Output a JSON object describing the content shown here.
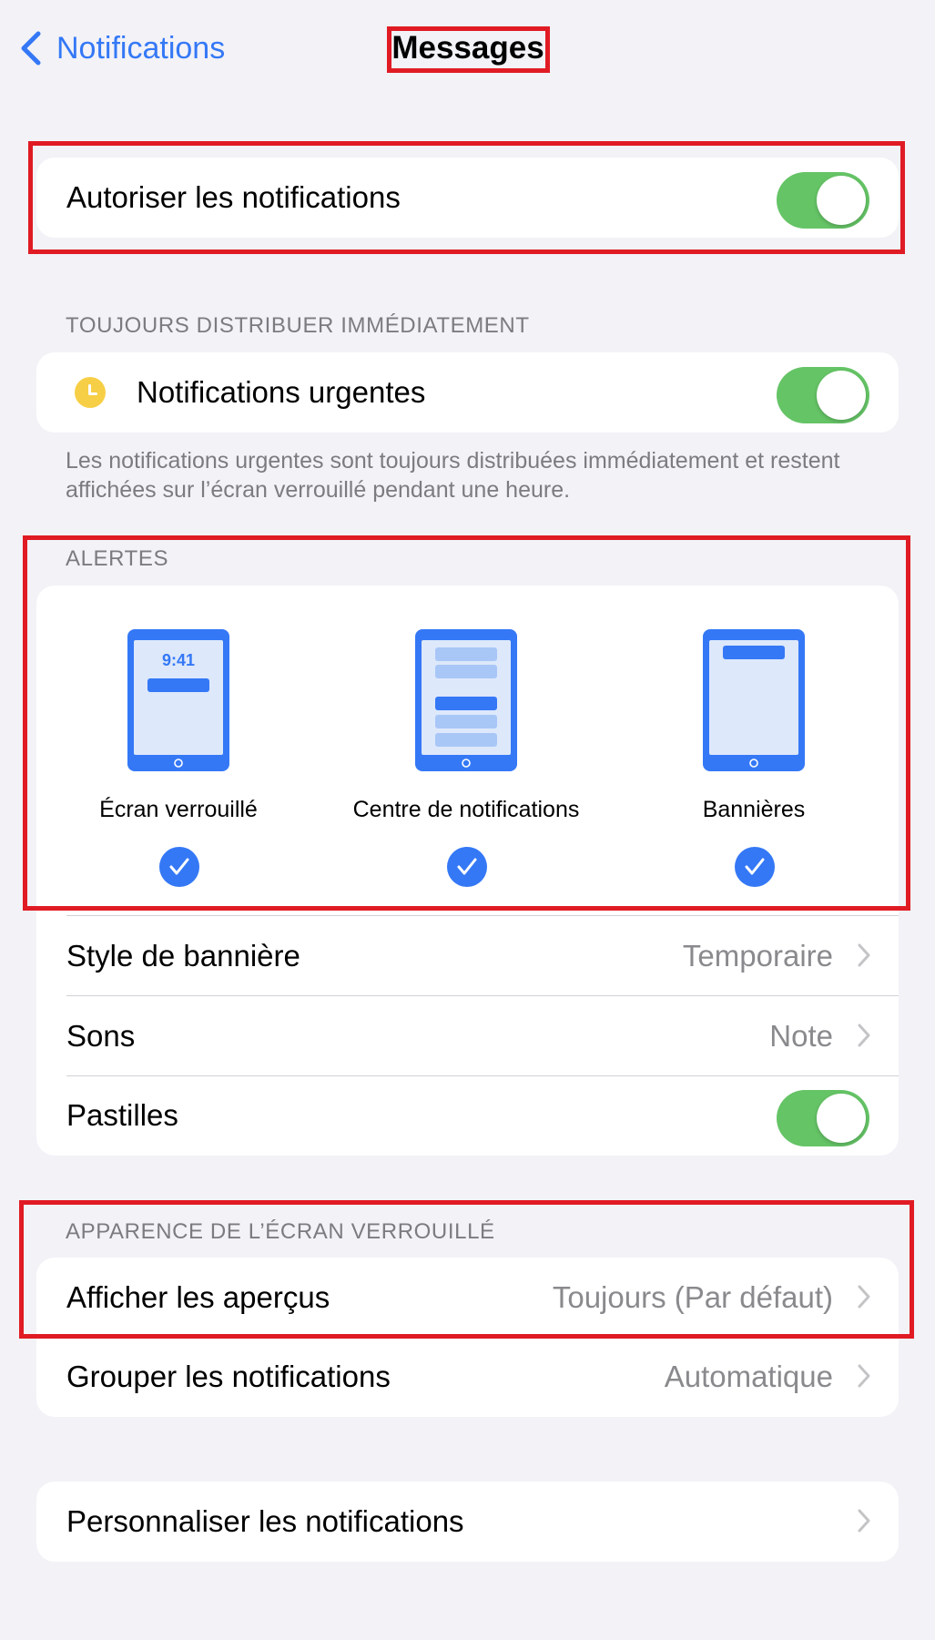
{
  "nav": {
    "back_label": "Notifications",
    "title": "Messages"
  },
  "allow": {
    "label": "Autoriser les notifications",
    "enabled": true
  },
  "urgent_section": {
    "header": "TOUJOURS DISTRIBUER IMMÉDIATEMENT",
    "label": "Notifications urgentes",
    "enabled": true,
    "footnote": "Les notifications urgentes sont toujours distribuées immédiatement et restent affichées sur l’écran verrouillé pendant une heure."
  },
  "alerts": {
    "header": "ALERTES",
    "options": [
      {
        "label": "Écran verrouillé",
        "time": "9:41",
        "checked": true
      },
      {
        "label": "Centre de notifications",
        "checked": true
      },
      {
        "label": "Bannières",
        "checked": true
      }
    ],
    "banner_style": {
      "label": "Style de bannière",
      "value": "Temporaire"
    },
    "sounds": {
      "label": "Sons",
      "value": "Note"
    },
    "badges": {
      "label": "Pastilles",
      "enabled": true
    }
  },
  "lock_screen": {
    "header": "APPARENCE DE L’ÉCRAN VERROUILLÉ",
    "previews": {
      "label": "Afficher les aperçus",
      "value": "Toujours (Par défaut)"
    },
    "grouping": {
      "label": "Grouper les notifications",
      "value": "Automatique"
    }
  },
  "customize": {
    "label": "Personnaliser les notifications"
  },
  "colors": {
    "accent": "#3478f6",
    "toggle_on": "#65c466",
    "highlight": "#e01b24",
    "background": "#f2f2f7"
  }
}
